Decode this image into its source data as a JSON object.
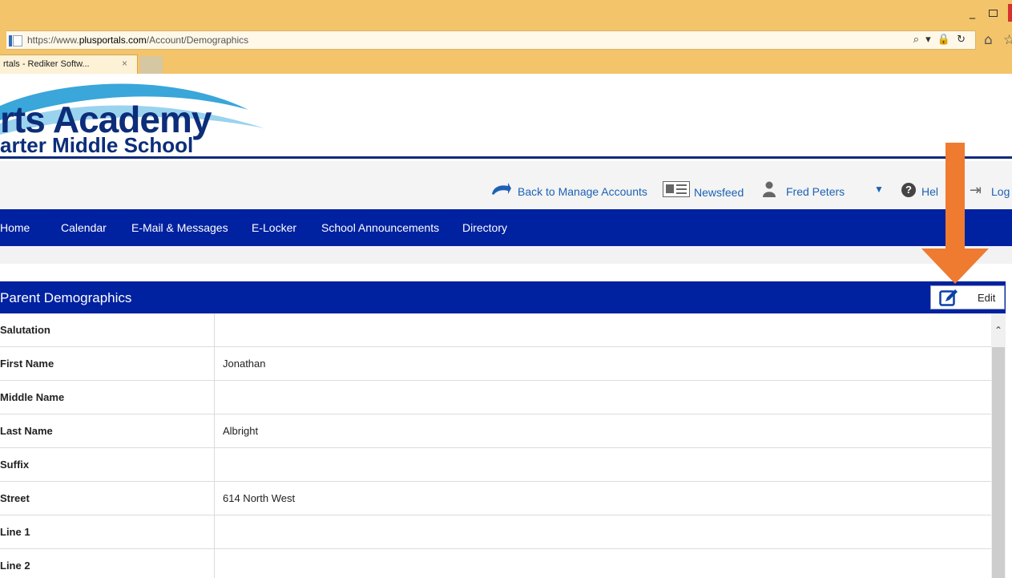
{
  "browser": {
    "url_prefix": "https://www.",
    "url_domain": "plusportals.com",
    "url_path": "/Account/Demographics",
    "tab_title": "rtals - Rediker Softw...",
    "tab_close": "×",
    "window_minimize": "_",
    "address_tools": "⌕ ▾ 🔒 ↻",
    "home": "⌂",
    "favorites": "☆"
  },
  "logo": {
    "line1": "rts Academy",
    "line2": "arter Middle School",
    "colors": {
      "text": "#0c2d7a",
      "swoosh": "#3aa6d9"
    }
  },
  "utility": {
    "back": "Back to Manage Accounts",
    "newsfeed": "Newsfeed",
    "user": "Fred Peters",
    "help": "Hel",
    "logout": "Log",
    "caret": "▼"
  },
  "nav": {
    "items": [
      "Home",
      "Calendar",
      "E-Mail & Messages",
      "E-Locker",
      "School Announcements",
      "Directory"
    ]
  },
  "panel": {
    "title": "Parent Demographics",
    "edit_label": "Edit",
    "rows": [
      {
        "label": "Salutation",
        "value": ""
      },
      {
        "label": "First Name",
        "value": "Jonathan"
      },
      {
        "label": "Middle Name",
        "value": ""
      },
      {
        "label": "Last Name",
        "value": "Albright"
      },
      {
        "label": "Suffix",
        "value": ""
      },
      {
        "label": "Street",
        "value": "614 North West"
      },
      {
        "label": "Line 1",
        "value": ""
      },
      {
        "label": "Line 2",
        "value": ""
      }
    ]
  },
  "colors": {
    "nav_bg": "#0021a0",
    "link": "#1c61b5",
    "arrow": "#ee7b30",
    "browser_chrome": "#f3c46a"
  }
}
